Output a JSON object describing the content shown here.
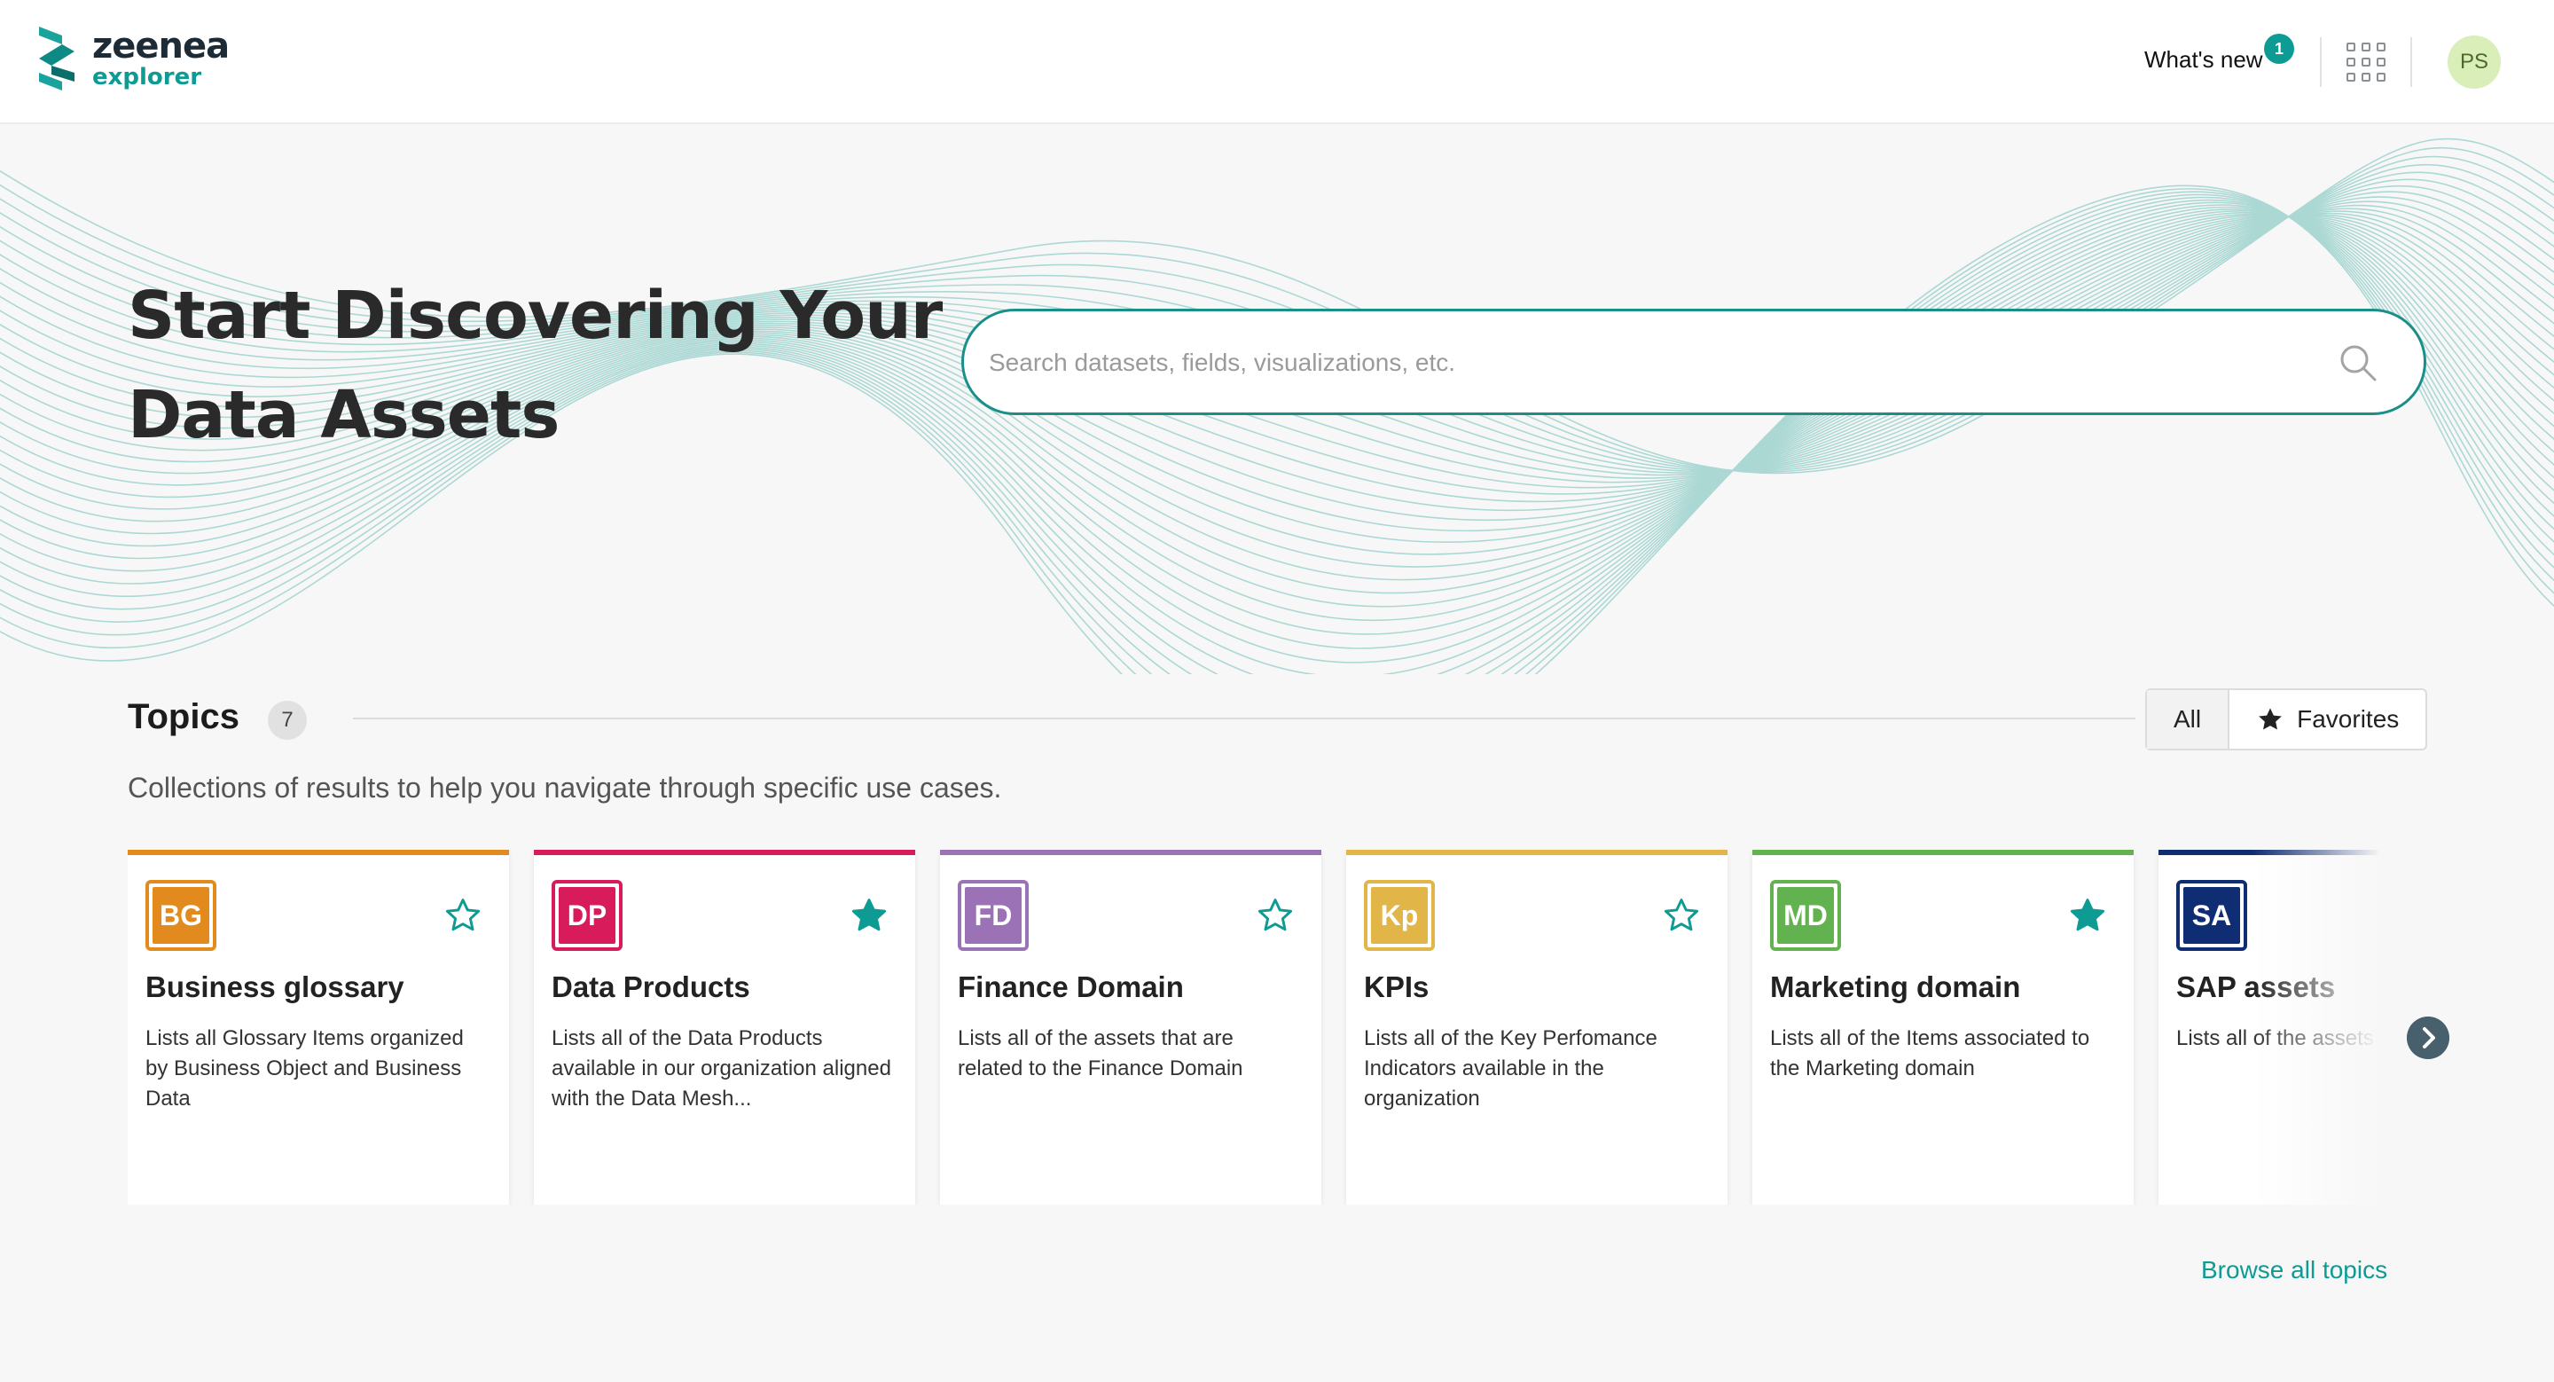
{
  "brand": {
    "name": "zeenea",
    "product": "explorer",
    "accent_color": "#0d9b94"
  },
  "header": {
    "whats_new_label": "What's new",
    "whats_new_count": "1",
    "apps_icon": "grid-icon",
    "avatar_initials": "PS"
  },
  "hero": {
    "title_line1": "Start Discovering Your",
    "title_line2": "Data Assets",
    "search_placeholder": "Search datasets, fields, visualizations, etc."
  },
  "topics": {
    "title": "Topics",
    "count": "7",
    "description": "Collections of results to help you navigate through specific use cases.",
    "filters": {
      "all_label": "All",
      "favorites_label": "Favorites",
      "selected": "All"
    },
    "browse_label": "Browse all topics",
    "cards": [
      {
        "abbr": "BG",
        "title": "Business glossary",
        "description": "Lists all Glossary Items organized by Business Object and Business Data",
        "color": "#e28a1e",
        "favorite": false
      },
      {
        "abbr": "DP",
        "title": "Data Products",
        "description": "Lists all of the Data Products available in our organization aligned with the Data Mesh...",
        "color": "#d81b5a",
        "favorite": true
      },
      {
        "abbr": "FD",
        "title": "Finance Domain",
        "description": "Lists all of the assets that are related to the Finance Domain",
        "color": "#9b72b6",
        "favorite": false
      },
      {
        "abbr": "Kp",
        "title": "KPIs",
        "description": "Lists all of the Key Perfomance Indicators available in the organization",
        "color": "#e2b548",
        "favorite": false
      },
      {
        "abbr": "MD",
        "title": "Marketing domain",
        "description": "Lists all of the Items associated to the Marketing domain",
        "color": "#62b34f",
        "favorite": true
      },
      {
        "abbr": "SA",
        "title": "SAP assets",
        "description": "Lists all of the assets for SAP tables",
        "color": "#0f2d73",
        "favorite": false
      }
    ]
  }
}
